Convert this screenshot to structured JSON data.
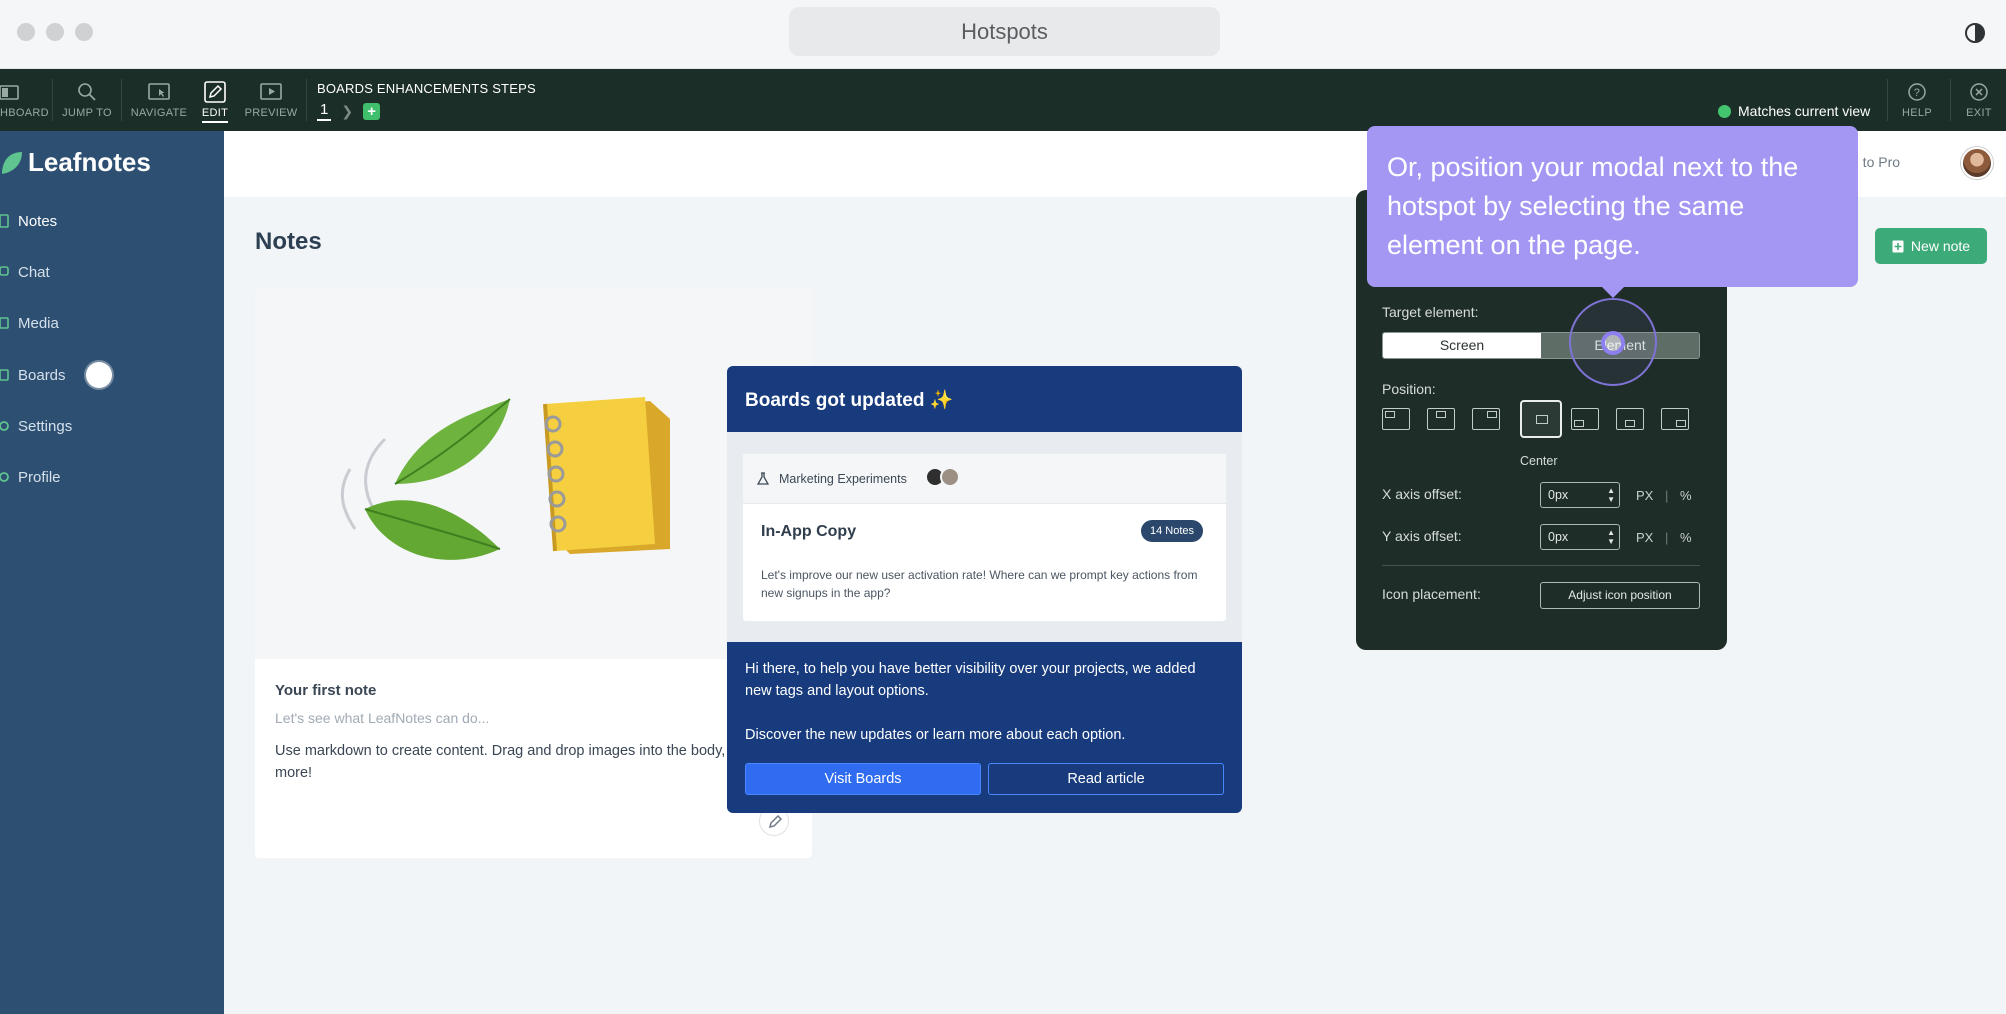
{
  "window": {
    "title": "Hotspots"
  },
  "toolbar": {
    "tools": [
      {
        "label": "HBOARD",
        "icon": "dashboard-back-icon"
      },
      {
        "label": "JUMP TO",
        "icon": "search-icon"
      },
      {
        "label": "NAVIGATE",
        "icon": "cursor-frame-icon"
      },
      {
        "label": "EDIT",
        "icon": "edit-icon",
        "active": true
      },
      {
        "label": "PREVIEW",
        "icon": "play-icon"
      }
    ],
    "flow_title": "BOARDS ENHANCEMENTS STEPS",
    "step_number": "1",
    "step_add": "+",
    "status": "Matches current view",
    "help_label": "HELP",
    "exit_label": "EXIT"
  },
  "app": {
    "logo": "Leafnotes",
    "nav": [
      {
        "label": "Notes",
        "active": true
      },
      {
        "label": "Chat"
      },
      {
        "label": "Media"
      },
      {
        "label": "Boards"
      },
      {
        "label": "Settings"
      },
      {
        "label": "Profile"
      }
    ],
    "switch_pro": "itch to Pro",
    "page_title": "Notes",
    "new_note": "New note",
    "note": {
      "title": "Your first note",
      "subtitle": "Let's see what LeafNotes can do...",
      "body": "Use markdown to create content. Drag and drop images into the body, notes and more!"
    }
  },
  "modal": {
    "title": "Boards got updated ✨",
    "preview": {
      "board_name": "Marketing Experiments",
      "card_title": "In-App Copy",
      "badge": "14 Notes",
      "card_text": "Let's improve our new user activation rate! Where can we prompt key actions from new signups in the app?"
    },
    "text_1": "Hi there, to help you have better visibility over your projects, we added new tags and layout options.",
    "text_2": "Discover the new updates or learn more about each option.",
    "primary_button": "Visit Boards",
    "secondary_button": "Read article"
  },
  "panel": {
    "target_label": "Target element:",
    "target_options": [
      "Screen",
      "Element"
    ],
    "target_selected": "Screen",
    "position_label": "Position:",
    "position_selected": "Center",
    "x_label": "X axis offset:",
    "x_value": "0px",
    "y_label": "Y axis offset:",
    "y_value": "0px",
    "unit_px": "PX",
    "unit_sep": "|",
    "unit_pct": "%",
    "icon_label": "Icon placement:",
    "icon_button": "Adjust icon position"
  },
  "tooltip": {
    "text": "Or, position your modal next to the hotspot by selecting the same element on the page."
  },
  "colors": {
    "toolbar_bg": "#1c2e28",
    "sidebar_bg": "#2d4f72",
    "modal_bg": "#173b7c",
    "tooltip_bg": "#a497f4",
    "accent_green": "#3daa79",
    "status_green": "#43c46f"
  }
}
